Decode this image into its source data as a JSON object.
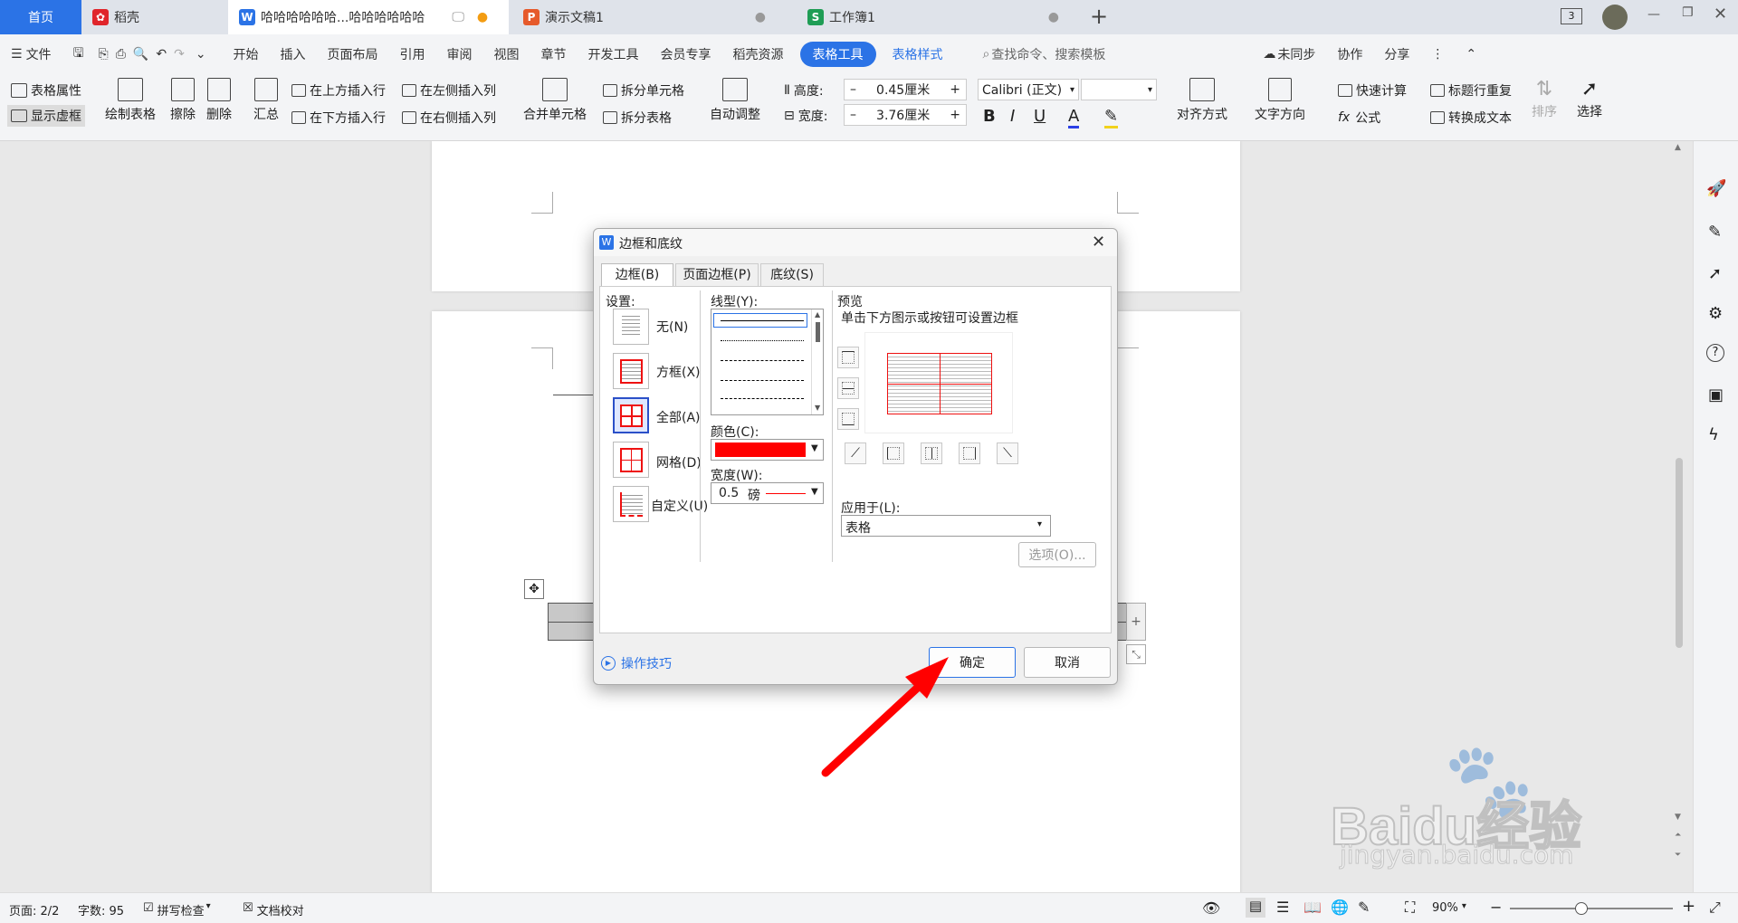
{
  "tabs": [
    {
      "label": "首页"
    },
    {
      "label": "稻壳"
    },
    {
      "label": "哈哈哈哈哈哈...哈哈哈哈哈哈"
    },
    {
      "label": "演示文稿1"
    },
    {
      "label": "工作簿1"
    }
  ],
  "titlebar": {
    "badge": "3"
  },
  "menu": {
    "file": "文件",
    "items": [
      "开始",
      "插入",
      "页面布局",
      "引用",
      "审阅",
      "视图",
      "章节",
      "开发工具",
      "会员专享",
      "稻壳资源",
      "表格工具",
      "表格样式"
    ],
    "search": "查找命令、搜索模板",
    "sync": "未同步",
    "collab": "协作",
    "share": "分享"
  },
  "ribbon": {
    "table_props": "表格属性",
    "show_grid": "显示虚框",
    "draw_table": "绘制表格",
    "erase": "擦除",
    "delete": "删除",
    "summary": "汇总",
    "insert_above": "在上方插入行",
    "insert_below": "在下方插入行",
    "insert_left": "在左侧插入列",
    "insert_right": "在右侧插入列",
    "merge": "合并单元格",
    "split_cell": "拆分单元格",
    "split_table": "拆分表格",
    "autofit": "自动调整",
    "height_label": "高度:",
    "height_value": "0.45厘米",
    "width_label": "宽度:",
    "width_value": "3.76厘米",
    "font": "Calibri (正文)",
    "align": "对齐方式",
    "text_dir": "文字方向",
    "quick_calc": "快速计算",
    "formula": "公式",
    "repeat_header": "标题行重复",
    "to_text": "转换成文本",
    "sort": "排序",
    "select": "选择"
  },
  "dialog": {
    "title": "边框和底纹",
    "tabs": [
      "边框(B)",
      "页面边框(P)",
      "底纹(S)"
    ],
    "settings_label": "设置:",
    "settings": [
      "无(N)",
      "方框(X)",
      "全部(A)",
      "网格(D)",
      "自定义(U)"
    ],
    "line_style_label": "线型(Y):",
    "color_label": "颜色(C):",
    "color_value": "#ff0000",
    "width_label": "宽度(W):",
    "width_value": "0.5",
    "width_unit": "磅",
    "preview_label": "预览",
    "preview_hint": "单击下方图示或按钮可设置边框",
    "apply_label": "应用于(L):",
    "apply_value": "表格",
    "options": "选项(O)...",
    "tips": "操作技巧",
    "ok": "确定",
    "cancel": "取消"
  },
  "status": {
    "page": "页面: 2/2",
    "words": "字数: 95",
    "spell": "拼写检查",
    "proof": "文档校对",
    "zoom": "90%"
  },
  "watermark": {
    "brand": "Baidu经验",
    "url": "jingyan.baidu.com"
  },
  "colors": {
    "accent": "#2b73e6",
    "annotation": "#ff0000"
  }
}
